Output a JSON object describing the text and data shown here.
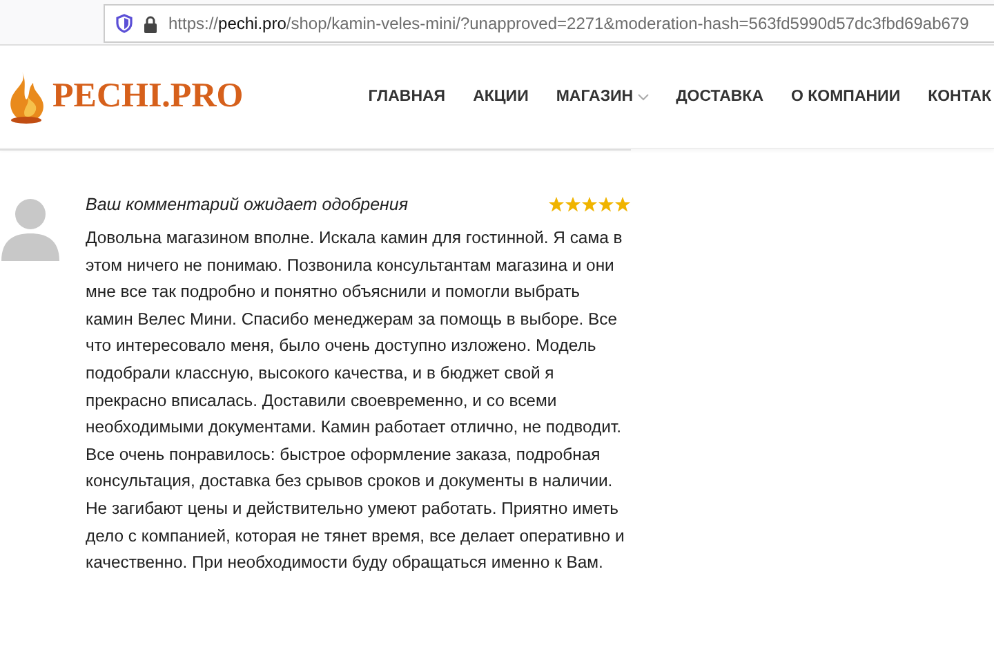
{
  "address_bar": {
    "scheme": "https://",
    "host": "pechi.pro",
    "path": "/shop/kamin-veles-mini/?unapproved=2271&moderation-hash=563fd5990d57dc3fbd69ab679"
  },
  "logo": {
    "text": "PECHI.PRO"
  },
  "nav": [
    {
      "label": "ГЛАВНАЯ",
      "dropdown": false
    },
    {
      "label": "АКЦИИ",
      "dropdown": false
    },
    {
      "label": "МАГАЗИН",
      "dropdown": true
    },
    {
      "label": "ДОСТАВКА",
      "dropdown": false
    },
    {
      "label": "О КОМПАНИИ",
      "dropdown": false
    },
    {
      "label": "КОНТАК",
      "dropdown": false
    }
  ],
  "comment": {
    "status": "Ваш комментарий ожидает одобрения",
    "stars": 5,
    "text": "Довольна магазином вполне. Искала камин для гостинной. Я сама в этом ничего не понимаю. Позвонила консультантам магазина и они мне все так подробно и понятно объяснили и помогли выбрать камин Велес Мини. Спасибо менеджерам за помощь в выборе. Все что интересовало меня, было очень доступно изложено. Модель подобрали классную, высокого качества, и в бюджет свой я прекрасно вписалась. Доставили своевременно, и со всеми необходимыми документами. Камин работает отлично, не подводит. Все очень понравилось: быстрое оформление заказа, подробная консультация, доставка без срывов сроков и документы в наличии. Не загибают цены и действительно умеют работать. Приятно иметь дело с компанией, которая не тянет время, все делает оперативно и качественно. При необходимости буду обращаться именно к Вам."
  }
}
